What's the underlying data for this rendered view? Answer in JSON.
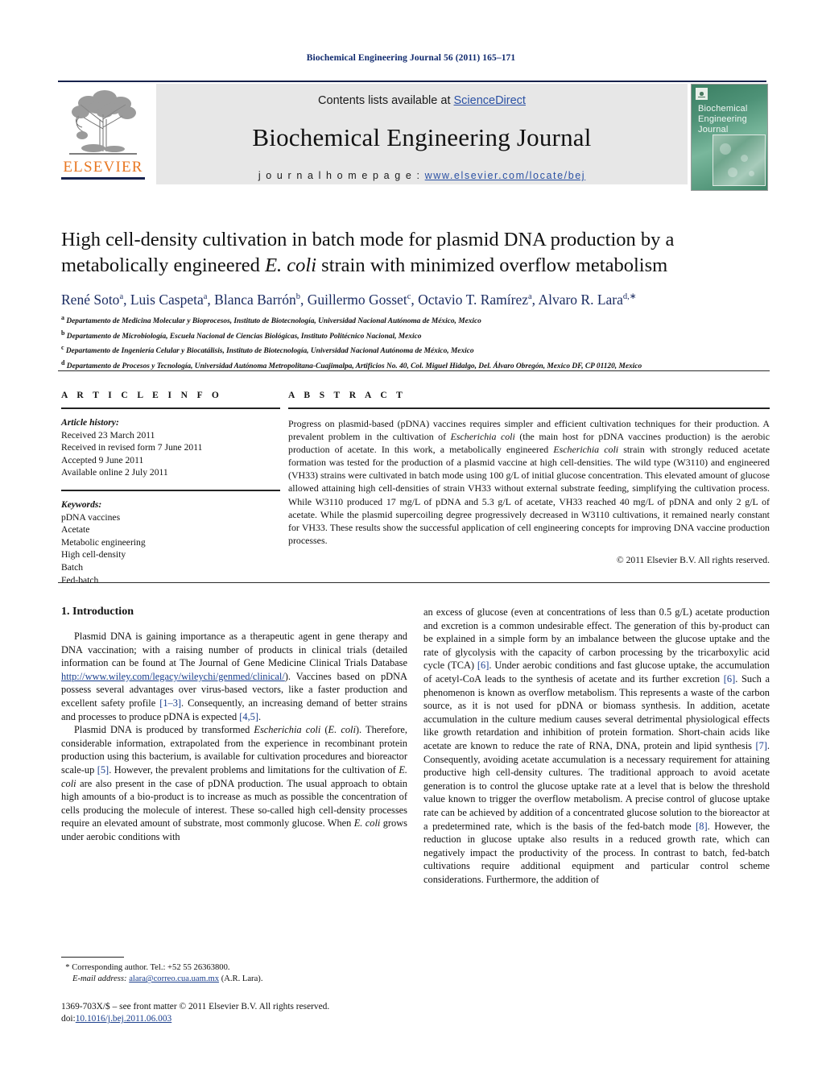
{
  "running_head": "Biochemical Engineering Journal 56 (2011) 165–171",
  "masthead": {
    "publisher_name": "ELSEVIER",
    "contents_prefix": "Contents lists available at ",
    "contents_link": "ScienceDirect",
    "journal_title": "Biochemical Engineering Journal",
    "homepage_prefix": "j o u r n a l  h o m e p a g e :  ",
    "homepage_url": "www.elsevier.com/locate/bej",
    "cover_title_lines": [
      "Biochemical",
      "Engineering",
      "Journal"
    ]
  },
  "article": {
    "title_line1": "High cell-density cultivation in batch mode for plasmid DNA production by a",
    "title_line2_a": "metabolically engineered ",
    "title_line2_italic": "E. coli",
    "title_line2_b": " strain with minimized overflow metabolism",
    "authors": [
      {
        "name": "René Soto",
        "sup": "a",
        "sep": ", "
      },
      {
        "name": "Luis Caspeta",
        "sup": "a",
        "sep": ", "
      },
      {
        "name": "Blanca Barrón",
        "sup": "b",
        "sep": ", "
      },
      {
        "name": "Guillermo Gosset",
        "sup": "c",
        "sep": ", "
      },
      {
        "name": "Octavio T. Ramírez",
        "sup": "a",
        "sep": ", "
      },
      {
        "name": "Alvaro R. Lara",
        "sup": "d,∗",
        "sep": ""
      }
    ],
    "affiliations": [
      {
        "sup": "a",
        "text": "Departamento de Medicina Molecular y Bioprocesos, Instituto de Biotecnología, Universidad Nacional Autónoma de México, Mexico"
      },
      {
        "sup": "b",
        "text": "Departamento de Microbiología, Escuela Nacional de Ciencias Biológicas, Instituto Politécnico Nacional, Mexico"
      },
      {
        "sup": "c",
        "text": "Departamento de Ingeniería Celular y Biocatálisis, Instituto de Biotecnología, Universidad Nacional Autónoma de México, Mexico"
      },
      {
        "sup": "d",
        "text": "Departamento de Procesos y Tecnología, Universidad Autónoma Metropolitana-Cuajimalpa, Artificios No. 40, Col. Miguel Hidalgo, Del. Álvaro Obregón, Mexico DF, CP 01120, Mexico"
      }
    ]
  },
  "article_info": {
    "heading": "A R T I C L E   I N F O",
    "history_label": "Article history:",
    "history": [
      "Received 23 March 2011",
      "Received in revised form 7 June 2011",
      "Accepted 9 June 2011",
      "Available online 2 July 2011"
    ],
    "keywords_label": "Keywords:",
    "keywords": [
      "pDNA vaccines",
      "Acetate",
      "Metabolic engineering",
      "High cell-density",
      "Batch",
      "Fed-batch"
    ]
  },
  "abstract": {
    "heading": "A B S T R A C T",
    "part1": "Progress on plasmid-based (pDNA) vaccines requires simpler and efficient cultivation techniques for their production. A prevalent problem in the cultivation of ",
    "italic1": "Escherichia coli",
    "part2": " (the main host for pDNA vaccines production) is the aerobic production of acetate. In this work, a metabolically engineered ",
    "italic2": "Escherichia coli",
    "part3": " strain with strongly reduced acetate formation was tested for the production of a plasmid vaccine at high cell-densities. The wild type (W3110) and engineered (VH33) strains were cultivated in batch mode using 100 g/L of initial glucose concentration. This elevated amount of glucose allowed attaining high cell-densities of strain VH33 without external substrate feeding, simplifying the cultivation process. While W3110 produced 17 mg/L of pDNA and 5.3 g/L of acetate, VH33 reached 40 mg/L of pDNA and only 2 g/L of acetate. While the plasmid supercoiling degree progressively decreased in W3110 cultivations, it remained nearly constant for VH33. These results show the successful application of cell engineering concepts for improving DNA vaccine production processes.",
    "copyright": "© 2011 Elsevier B.V. All rights reserved."
  },
  "body": {
    "section_heading": "1.  Introduction",
    "left": {
      "p1_a": "Plasmid DNA is gaining importance as a therapeutic agent in gene therapy and DNA vaccination; with a raising number of products in clinical trials (detailed information can be found at The Journal of Gene Medicine Clinical Trials Database ",
      "p1_link": "http://www.wiley.com/legacy/wileychi/genmed/clinical/",
      "p1_b": "). Vaccines based on pDNA possess several advantages over virus-based vectors, like a faster production and excellent safety profile ",
      "p1_ref1": "[1–3]",
      "p1_c": ". Consequently, an increasing demand of better strains and processes to produce pDNA is expected ",
      "p1_ref2": "[4,5]",
      "p1_d": ".",
      "p2_a": "Plasmid DNA is produced by transformed ",
      "p2_i1": "Escherichia coli",
      "p2_b": " (",
      "p2_i2": "E. coli",
      "p2_c": "). Therefore, considerable information, extrapolated from the experience in recombinant protein production using this bacterium, is available for cultivation procedures and bioreactor scale-up ",
      "p2_ref1": "[5]",
      "p2_d": ". However, the prevalent problems and limitations for the cultivation of ",
      "p2_i3": "E. coli",
      "p2_e": " are also present in the case of pDNA production. The usual approach to obtain high amounts of a bio-product is to increase as much as possible the concentration of cells producing the molecule of interest. These so-called high cell-density processes require an elevated amount of substrate, most commonly glucose. When ",
      "p2_i4": "E. coli",
      "p2_f": " grows under aerobic conditions with"
    },
    "right": {
      "p3_a": "an excess of glucose (even at concentrations of less than 0.5 g/L) acetate production and excretion is a common undesirable effect. The generation of this by-product can be explained in a simple form by an imbalance between the glucose uptake and the rate of glycolysis with the capacity of carbon processing by the tricarboxylic acid cycle (TCA) ",
      "p3_ref1": "[6]",
      "p3_b": ". Under aerobic conditions and fast glucose uptake, the accumulation of acetyl-CoA leads to the synthesis of acetate and its further excretion ",
      "p3_ref2": "[6]",
      "p3_c": ". Such a phenomenon is known as overflow metabolism. This represents a waste of the carbon source, as it is not used for pDNA or biomass synthesis. In addition, acetate accumulation in the culture medium causes several detrimental physiological effects like growth retardation and inhibition of protein formation. Short-chain acids like acetate are known to reduce the rate of RNA, DNA, protein and lipid synthesis ",
      "p3_ref3": "[7]",
      "p3_d": ". Consequently, avoiding acetate accumulation is a necessary requirement for attaining productive high cell-density cultures. The traditional approach to avoid acetate generation is to control the glucose uptake rate at a level that is below the threshold value known to trigger the overflow metabolism. A precise control of glucose uptake rate can be achieved by addition of a concentrated glucose solution to the bioreactor at a predetermined rate, which is the basis of the fed-batch mode ",
      "p3_ref4": "[8]",
      "p3_e": ". However, the reduction in glucose uptake also results in a reduced growth rate, which can negatively impact the productivity of the process. In contrast to batch, fed-batch cultivations require additional equipment and particular control scheme considerations. Furthermore, the addition of"
    }
  },
  "footer": {
    "corresponding_marker": "*",
    "corresponding": " Corresponding author. Tel.: +52 55 26363800.",
    "email_label": "E-mail address:",
    "email": "alara@correo.cua.uam.mx",
    "email_owner": " (A.R. Lara).",
    "issn_line": "1369-703X/$ – see front matter © 2011 Elsevier B.V. All rights reserved.",
    "doi_label": "doi:",
    "doi": "10.1016/j.bej.2011.06.003"
  },
  "colors": {
    "link": "#1a3e8c",
    "sciencedirect": "#2b51a4",
    "elsevier_orange": "#e87722",
    "running_head": "#102a6e",
    "authors": "#1c2d62"
  }
}
